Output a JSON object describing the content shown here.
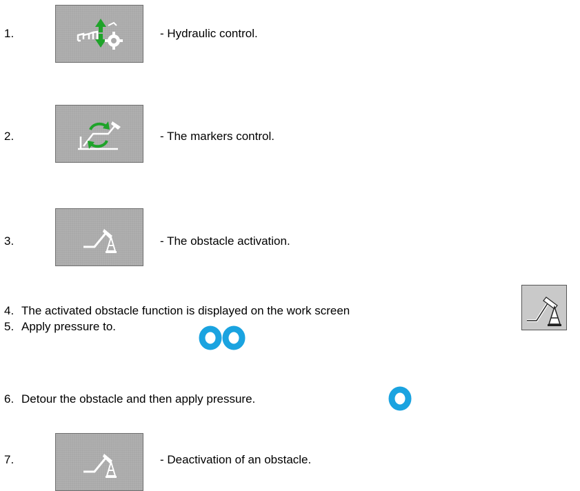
{
  "steps": [
    {
      "number": "1.",
      "text": "- Hydraulic control.",
      "icon": "hydraulic-control-icon"
    },
    {
      "number": "2.",
      "text": "- The markers control.",
      "icon": "markers-control-icon"
    },
    {
      "number": "3.",
      "text": "- The obstacle activation.",
      "icon": "obstacle-icon"
    },
    {
      "number": "4.",
      "text": "The activated obstacle function is displayed on the work screen",
      "icon": "obstacle-indicator-icon"
    },
    {
      "number": "5.",
      "text": "Apply pressure to.",
      "icon": "double-press-icon"
    },
    {
      "number": "6.",
      "text": "Detour the obstacle and then apply pressure.",
      "icon": "single-press-icon"
    },
    {
      "number": "7.",
      "text": "- Deactivation of an obstacle.",
      "icon": "obstacle-icon"
    }
  ],
  "colors": {
    "button_bg": "#a9a9a9",
    "ring": "#1aa3e0",
    "arrow_green": "#1fa32a",
    "icon_white": "#ffffff"
  }
}
